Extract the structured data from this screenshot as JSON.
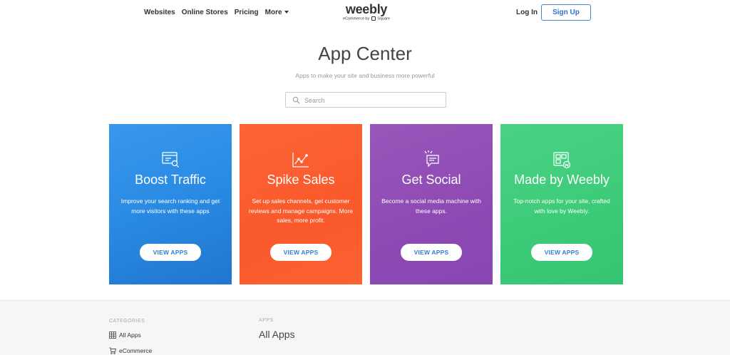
{
  "nav": {
    "links": [
      "Websites",
      "Online Stores",
      "Pricing",
      "More"
    ],
    "logo": "weebly",
    "logo_sub_prefix": "eCommerce by",
    "logo_sub_brand": "Square",
    "login": "Log In",
    "signup": "Sign Up"
  },
  "hero": {
    "title": "App Center",
    "subtitle": "Apps to make your site and business more powerful",
    "search_placeholder": "Search"
  },
  "cards": [
    {
      "title": "Boost Traffic",
      "description": "Improve your search ranking and get more visitors with these apps",
      "button": "VIEW APPS",
      "color": "#2d8fe6",
      "icon": "browser-search-icon"
    },
    {
      "title": "Spike Sales",
      "description": "Set up sales channels, get customer reviews and manage campaigns. More sales, more profit.",
      "button": "VIEW APPS",
      "color": "#fb5a2c",
      "icon": "line-chart-icon"
    },
    {
      "title": "Get Social",
      "description": "Become a social media machine with these apps.",
      "button": "VIEW APPS",
      "color": "#8f4bb4",
      "icon": "chat-bubble-icon"
    },
    {
      "title": "Made by Weebly",
      "description": "Top-notch apps for your site, crafted with love by Weebly.",
      "button": "VIEW APPS",
      "color": "#3dcc7a",
      "icon": "weebly-grid-icon"
    }
  ],
  "lower": {
    "categories_label": "CATEGORIES",
    "categories": [
      {
        "label": "All Apps",
        "icon": "grid-icon"
      },
      {
        "label": "eCommerce",
        "icon": "cart-icon"
      }
    ],
    "apps_label": "APPS",
    "apps_title": "All Apps"
  },
  "colors": {
    "accent": "#2f75c4"
  }
}
